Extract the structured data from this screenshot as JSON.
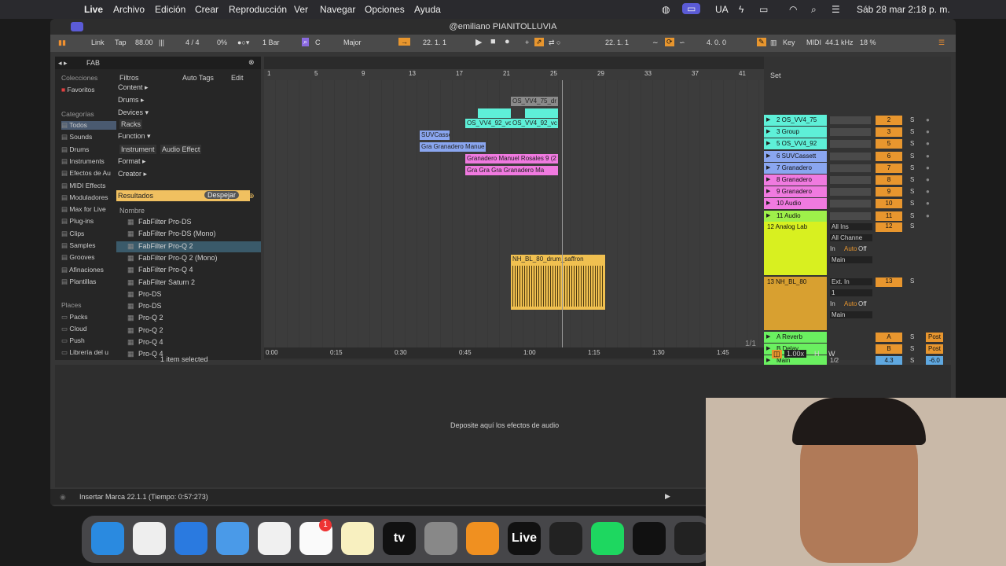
{
  "menubar": {
    "app": "Live",
    "items": [
      "Archivo",
      "Edición",
      "Crear",
      "Reproducción",
      "Ver",
      "Navegar",
      "Opciones",
      "Ayuda"
    ],
    "lang": "UA",
    "datetime": "Sáb 28 mar 2:18 p. m."
  },
  "window": {
    "title": "@emiliano PIANITOLLUVIA"
  },
  "transport": {
    "link": "Link",
    "tap": "Tap",
    "tempo": "88.00",
    "sig": "4 / 4",
    "cpu_pct": "0%",
    "quant": "1 Bar",
    "key": "C",
    "scale": "Major",
    "pos1": "22.  1.  1",
    "pos2": "22.  1.  1",
    "loop_len": "4.  0.  0",
    "key_btn": "Key",
    "midi": "MIDI",
    "rate": "44.1 kHz",
    "cpu": "18 %"
  },
  "browser": {
    "search": "FAB",
    "collections_header": "Colecciones",
    "favorites": "Favoritos",
    "categories_header": "Categorías",
    "categories": [
      "Todos",
      "Sounds",
      "Drums",
      "Instruments",
      "Efectos de Au",
      "MIDI Effects",
      "Moduladores",
      "Max for Live",
      "Plug-ins",
      "Clips",
      "Samples",
      "Grooves",
      "Afinaciones",
      "Plantillas"
    ],
    "places_header": "Places",
    "places": [
      "Packs",
      "Cloud",
      "Push",
      "Librería del u"
    ],
    "filters": "Filtros",
    "auto_tags": "Auto Tags",
    "edit": "Edit",
    "filter_groups": [
      "Content ▸",
      "Drums ▸",
      "Devices ▾",
      "Racks",
      "Function ▾",
      "Instrument",
      "Audio Effect",
      "Format ▸",
      "Creator ▸"
    ],
    "results": "Resultados",
    "clear": "Despejar",
    "name_col": "Nombre",
    "items": [
      "FabFilter Pro-DS",
      "FabFilter Pro-DS (Mono)",
      "FabFilter Pro-Q 2",
      "FabFilter Pro-Q 2 (Mono)",
      "FabFilter Pro-Q 4",
      "FabFilter Saturn 2",
      "Pro-DS",
      "Pro-DS",
      "Pro-Q 2",
      "Pro-Q 2",
      "Pro-Q 4",
      "Pro-Q 4"
    ],
    "selected_count": "1 item selected"
  },
  "arrangement": {
    "bars": [
      "1",
      "5",
      "9",
      "13",
      "17",
      "21",
      "25",
      "29",
      "33",
      "37",
      "41"
    ],
    "set_label": "Set",
    "times": [
      "0:00",
      "0:15",
      "0:30",
      "0:45",
      "1:00",
      "1:15",
      "1:30",
      "1:45"
    ],
    "page": "1/1",
    "zoom": "1.00x",
    "h": "H",
    "w": "W"
  },
  "clips": [
    {
      "label": "OS_VV4_75_dr",
      "color": "#8a8a8a"
    },
    {
      "label": "",
      "color": "#5ef0d8"
    },
    {
      "label": "",
      "color": "#5ef0d8"
    },
    {
      "label": "OS_VV4_92_vc",
      "color": "#5ef0d8"
    },
    {
      "label": "OS_VV4_92_vc",
      "color": "#5ef0d8"
    },
    {
      "label": "SUVCasse",
      "color": "#8aa6f0"
    },
    {
      "label": "Gra Granadero Manue",
      "color": "#8aa6f0"
    },
    {
      "label": "Granadero Manuel Rosales 9 (2",
      "color": "#f07ae0"
    },
    {
      "label": "Gra Gra Gra Granadero Ma",
      "color": "#f07ae0"
    },
    {
      "label": "NH_BL_80_drum_saffron",
      "color": "#f0c050"
    }
  ],
  "tracks": [
    {
      "name": "2 OS_VV4_75",
      "num": "2",
      "color": "#5ef0d8"
    },
    {
      "name": "3 Group",
      "num": "3",
      "color": "#5ef0d8"
    },
    {
      "name": "5 OS_VV4_92",
      "num": "5",
      "color": "#5ef0d8"
    },
    {
      "name": "6 SUVCassett",
      "num": "6",
      "color": "#8aa6f0"
    },
    {
      "name": "7 Granadero",
      "num": "7",
      "color": "#8aa6f0"
    },
    {
      "name": "8 Granadero",
      "num": "8",
      "color": "#f07ae0"
    },
    {
      "name": "9 Granadero",
      "num": "9",
      "color": "#f07ae0"
    },
    {
      "name": "10 Audio",
      "num": "10",
      "color": "#f07ae0"
    },
    {
      "name": "11 Audio",
      "num": "11",
      "color": "#9ef04a"
    }
  ],
  "big_tracks": [
    {
      "name": "12 Analog Lab",
      "num": "12",
      "input": "All Ins",
      "channel": "All Channe",
      "monitor": [
        "In",
        "Auto",
        "Off"
      ],
      "out": "Main",
      "color": "#d8f020"
    },
    {
      "name": "13  NH_BL_80",
      "num": "13",
      "input": "Ext. In",
      "channel": "1",
      "monitor": [
        "In",
        "Auto",
        "Off"
      ],
      "out": "Main",
      "color": "#d8a030"
    }
  ],
  "returns": [
    {
      "name": "A Reverb",
      "num": "A",
      "post": "Post"
    },
    {
      "name": "B Delay",
      "num": "B",
      "post": "Post"
    },
    {
      "name": "Main",
      "num": "4.3",
      "post": "-6.0",
      "sub": "1/2"
    }
  ],
  "lower": {
    "drop_hint": "Deposite aquí los efectos de audio"
  },
  "status": {
    "text": "Insertar Marca 22.1.1 (Tiempo: 0:57:273)"
  },
  "dock": {
    "apps": [
      "finder-icon",
      "launchpad-icon",
      "safari-icon",
      "mail-icon",
      "photos-icon",
      "reminders-icon",
      "notes-icon",
      "appletv-icon",
      "settings-icon",
      "fl-studio-icon",
      "live-icon",
      "capcut-icon",
      "spotify-icon",
      "audio-icon",
      "obs-icon"
    ],
    "reminders_badge": "1",
    "live_label": "Live",
    "tv_label": "tv"
  }
}
